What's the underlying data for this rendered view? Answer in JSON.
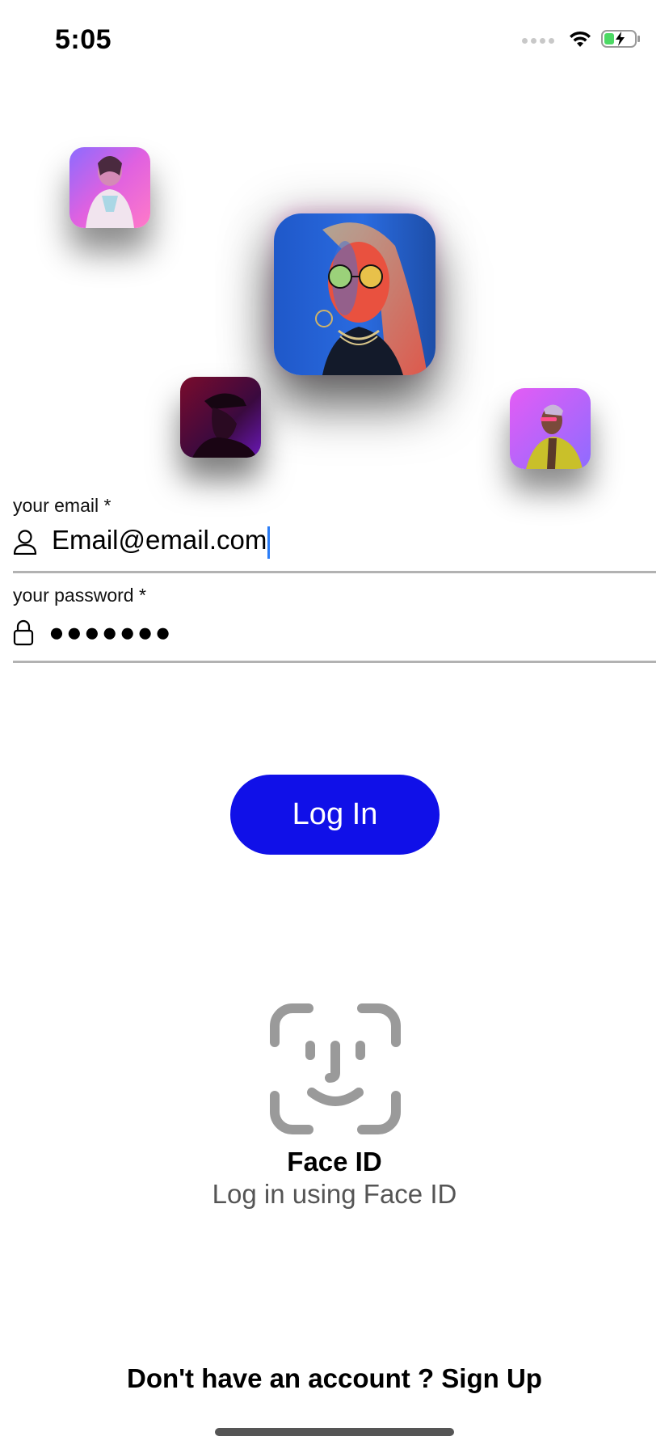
{
  "status_bar": {
    "time": "5:05",
    "icons": [
      "signal-icon",
      "wifi-icon",
      "battery-charging-icon"
    ]
  },
  "avatars": [
    {
      "name": "avatar-woman-pink",
      "colors": [
        "#d94fd9",
        "#7d5cff"
      ]
    },
    {
      "name": "avatar-woman-glasses",
      "colors": [
        "#1d5ed6",
        "#ff2a3a"
      ]
    },
    {
      "name": "avatar-man-cap",
      "colors": [
        "#2a0b35",
        "#c3145a"
      ]
    },
    {
      "name": "avatar-man-purple",
      "colors": [
        "#cf55ff",
        "#8b63ff"
      ]
    }
  ],
  "form": {
    "email_label": "your email *",
    "email_value": "Email@email.com",
    "password_label": "your password *",
    "password_value": "●●●●●●●",
    "login_button": "Log In"
  },
  "face_id": {
    "title": "Face ID",
    "subtitle": "Log in using Face ID",
    "icon": "face-id-icon",
    "color": "#9a9a9a"
  },
  "signup": {
    "prefix": "Don't have an account ? ",
    "link": "Sign Up"
  },
  "colors": {
    "accent": "#1010e8",
    "caret": "#2b7df7",
    "divider": "#b2b2b2",
    "battery_fill": "#4cd964"
  }
}
